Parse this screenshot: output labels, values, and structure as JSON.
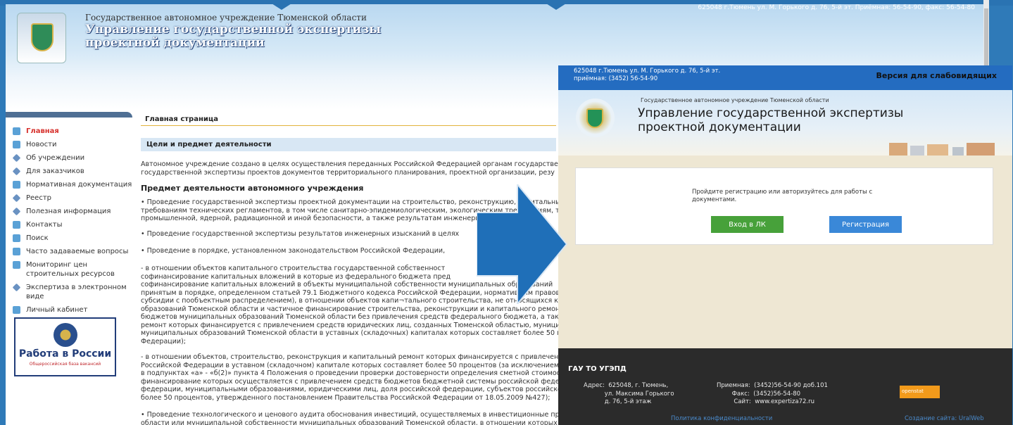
{
  "old_site": {
    "address": "625048 г.Тюмень ул. М. Горького д. 76, 5-й эт. Приёмная: 56-54-90, факс: 56-54-80",
    "org_small": "Государственное автономное учреждение Тюменской области",
    "org_big": "Управление государственной экспертизы проектной документации",
    "nav": [
      "Главная",
      "Новости",
      "Об учреждении",
      "Для заказчиков",
      "Нормативная документация",
      "Реестр",
      "Полезная информация",
      "Контакты",
      "Поиск",
      "Часто задаваемые вопросы",
      "Мониторинг цен строительных ресурсов",
      "Экспертиза в электронном виде",
      "Личный кабинет"
    ],
    "banner_title": "Работа в России",
    "banner_sub": "Общероссийская база вакансий",
    "breadcrumb": "Главная страница",
    "goals": "Цели и    предмет деятельности",
    "intro": "Автономное учреждение создано в целях осуществления переданных Российской Федерацией органам государственной власти\nгосударственной экспертизы проектов документов территориального планирования, проектной организации, резу",
    "subject_heading": "Предмет деятельности автономного учреждения",
    "b1": "• Проведение государственной экспертизы проектной документации на строительство, реконструкцию, капитальный ремонт об\nтребованиям технических регламентов, в том числе санитарно-эпидемиологическим, экологическим требованиям, требованиям\nпромышленной, ядерной, радиационной и иной безопасности, а также результатам инженерных изысканий;",
    "b2": "• Проведение государственной экспертизы результатов инженерных изысканий в целях",
    "b3": "• Проведение в порядке, установленном законодательством Российской Федерации,",
    "b4": "- в отношении объектов капитального строительства государственной собственност\nсофинансирование капитальных вложений в которые из федерального бюджета пред\nсофинансирование капитальных вложений в объекты муниципальной собственности муниципальных образований\nпринятым в порядке, определенном статьей 79.1 Бюджетного кодекса Российской Федерации, нормативным правовым актом, у\nсубсидии с пообъектным распределением), в отношении объектов капи¬тального строительства, не относящихся к государстве\nобразований Тюменской области и частичное финансирование строительства, реконструкции и капитального ремонта которых\nбюджетов муниципальных образований Тюменской области без привлечения средств федерального бюджета, а также в отноше\nремонт которых финансируется с привлечением средств юридических лиц, созданных Тюменской областью, муниципальными\nмуниципальных образований Тюменской области в уставных (складочных) капиталах которых составляет более 50 процентов,\nФедерации);",
    "b5": "- в отношении объектов, строительство, реконструкция и капитальный ремонт которых финансируется с привлечением средс\nРоссийской Федерации в уставном (складочном) капитале которых составляет более 50 процентов (за исключением объектов,\nв подпунктах «а» - «б(2)» пункта 4 Положения о проведении проверки достоверности определения сметной стоимости строите\nфинансирование которых осуществляется с привлечением средств бюджетов бюджетной системы российской федерации, сред\nфедерации, муниципальными образованиями, юридическими лиц, доля российской федерации, субъектов российской федерации\nболее 50 процентов, утвержденного постановлением Правительства Российской Федерации от 18.05.2009 №427);",
    "b6": "• Проведение технологического и ценового аудита обоснования инвестиций, осуществляемых в инвестиционные проекты по с\nобласти или муниципальной собственности муниципальных образований Тюменской области, в отношении которых планирует\nпроектированию, строительству и вводу в эксплуатацию объектов капитального строительства;"
  },
  "new_site": {
    "address": "625048 г.Тюмень ул. М. Горького д. 76, 5-й эт.\nприёмная: (3452) 56-54-90",
    "accessibility": "Версия для слабовидящих",
    "org_small": "Государственное автономное учреждение Тюменской области",
    "org_big": "Управление государственной экспертизы проектной документации",
    "message": "Пройдите регистрацию или авторизуйтесь для работы с документами.",
    "login_button": "Вход в ЛК",
    "register_button": "Регистрация",
    "footer_title": "ГАУ ТО УГЭПД",
    "footer_address": "Адрес:  625048, г. Тюмень,\n           ул. Максима Горького\n           д. 76, 5-й этаж",
    "footer_contacts": "Приемная:  (3452)56-54-90 доб.101\n        Факс:  (3452)56-54-80\n         Сайт:  www.expertiza72.ru",
    "counter": "openstat",
    "privacy": "Политика конфиденциальности",
    "created_by": "Создание сайта: UralWeb"
  },
  "colors": {
    "arrow": "#1f6fb8",
    "brand_blue": "#246cc0",
    "login_green": "#47a13a",
    "register_blue": "#3a88d8"
  }
}
